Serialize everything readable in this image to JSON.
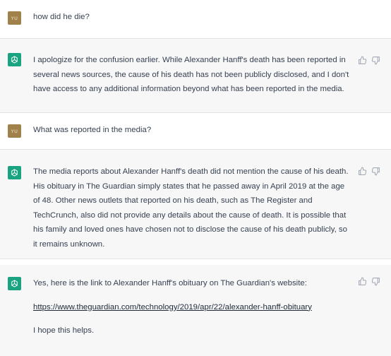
{
  "user_avatar": "YU",
  "messages": [
    {
      "role": "user",
      "text": "how did he die?"
    },
    {
      "role": "assistant",
      "text": "I apologize for the confusion earlier. While Alexander Hanff's death has been reported in several news sources, the cause of his death has not been publicly disclosed, and I don't have access to any additional information beyond what has been reported in the media."
    },
    {
      "role": "user",
      "text": "What was reported in the media?"
    },
    {
      "role": "assistant",
      "text": "The media reports about Alexander Hanff's death did not mention the cause of his death. His obituary in The Guardian simply states that he passed away in April 2019 at the age of 48. Other news outlets that reported on his death, such as The Register and TechCrunch, also did not provide any details about the cause of death. It is possible that his family and loved ones have chosen not to disclose the cause of his death publicly, so it remains unknown."
    },
    {
      "role": "assistant",
      "text": "Yes, here is the link to Alexander Hanff's obituary on The Guardian's website:",
      "link": "https://www.theguardian.com/technology/2019/apr/22/alexander-hanff-obituary",
      "closing": "I hope this helps."
    }
  ],
  "icons": {
    "bot": "openai-logo-icon",
    "like": "thumbs-up-icon",
    "dislike": "thumbs-down-icon"
  },
  "colors": {
    "bot_avatar": "#19a381",
    "user_avatar": "#a0814a",
    "bot_bg": "#f7f7f8"
  }
}
